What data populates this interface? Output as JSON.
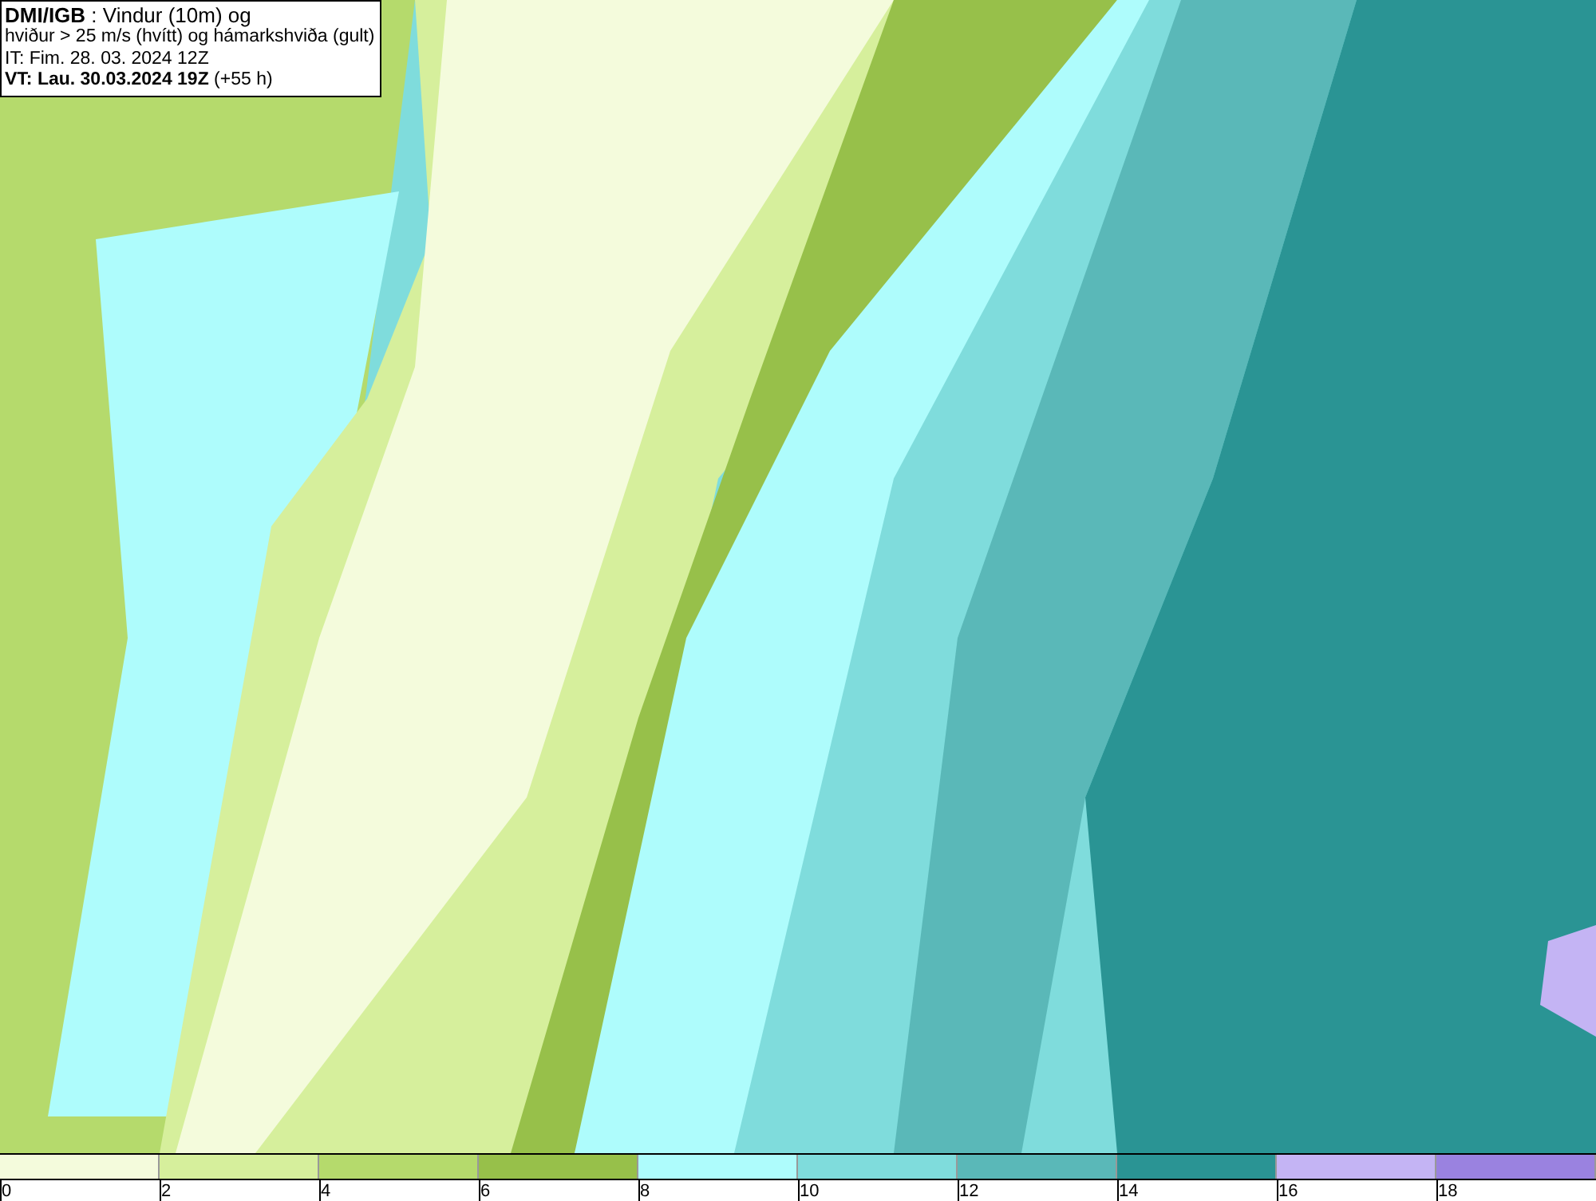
{
  "info_box": {
    "lines": [
      {
        "kind": "title",
        "text": "**DMI/IGB** : Vindur (10m) og"
      },
      {
        "kind": "plain",
        "text": "hviður > 25 m/s (hvítt) og hámarkshviða (gult)"
      },
      {
        "kind": "plain",
        "text": "IT: Fim. 28. 03. 2024 12Z"
      },
      {
        "kind": "plain",
        "text": "**VT: Lau. 30.03.2024 19Z** (+55 h)"
      }
    ]
  },
  "legend": [
    {
      "label": "0",
      "color": "#f4fbdc"
    },
    {
      "label": "2",
      "color": "#d6ef9c"
    },
    {
      "label": "4",
      "color": "#b5da6c"
    },
    {
      "label": "6",
      "color": "#97c04a"
    },
    {
      "label": "8",
      "color": "#aefcfc"
    },
    {
      "label": "10",
      "color": "#7fdcdc"
    },
    {
      "label": "12",
      "color": "#5ab8b8"
    },
    {
      "label": "14",
      "color": "#2a9494"
    },
    {
      "label": "16",
      "color": "#c4b4f4"
    },
    {
      "label": "18",
      "color": "#9a82e0"
    }
  ]
}
